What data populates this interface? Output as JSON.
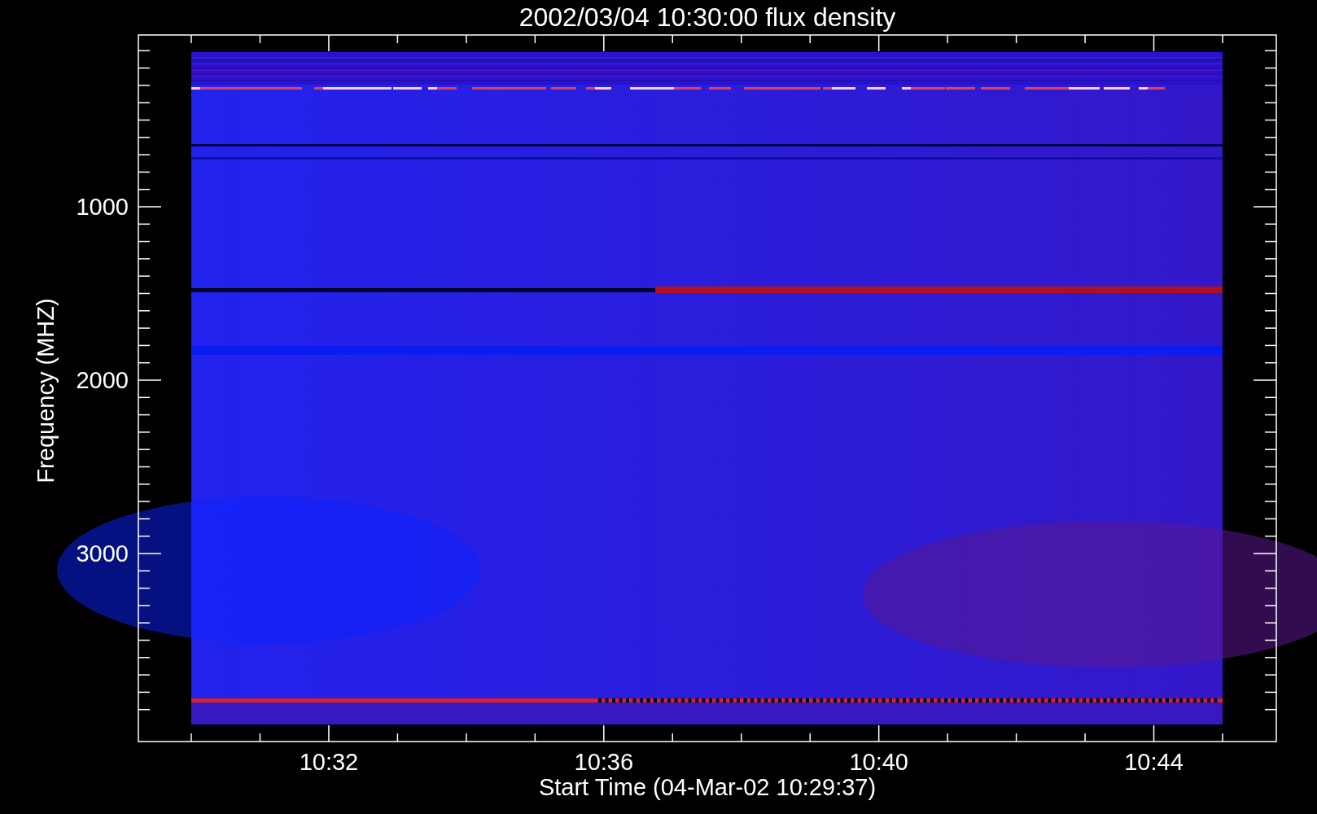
{
  "plot": {
    "title": "2002/03/04 10:30:00 flux density",
    "ylabel": "Frequency (MHZ)",
    "xlabel": "Start Time (04-Mar-02 10:29:37)",
    "yticks": [
      "1000",
      "2000",
      "3000"
    ],
    "xticks": [
      "10:32",
      "10:36",
      "10:40",
      "10:44"
    ]
  }
}
